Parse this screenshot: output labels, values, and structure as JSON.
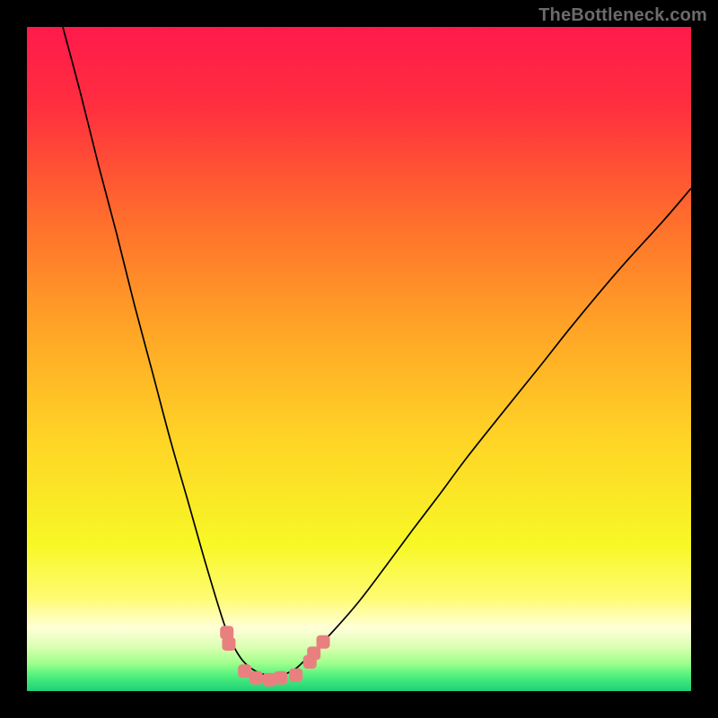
{
  "watermark": "TheBottleneck.com",
  "chart_data": {
    "type": "line",
    "title": "",
    "xlabel": "",
    "ylabel": "",
    "xlim": [
      0,
      100
    ],
    "ylim": [
      0,
      100
    ],
    "grid": false,
    "annotations": [],
    "gradient_stops": [
      {
        "offset": 0.0,
        "color": "#ff1a4b"
      },
      {
        "offset": 0.12,
        "color": "#ff2f3f"
      },
      {
        "offset": 0.28,
        "color": "#ff6a2d"
      },
      {
        "offset": 0.45,
        "color": "#ffa326"
      },
      {
        "offset": 0.62,
        "color": "#ffd426"
      },
      {
        "offset": 0.78,
        "color": "#f7f826"
      },
      {
        "offset": 0.86,
        "color": "#fffb73"
      },
      {
        "offset": 0.905,
        "color": "#ffffd8"
      },
      {
        "offset": 0.935,
        "color": "#d8ffb0"
      },
      {
        "offset": 0.958,
        "color": "#9fff8c"
      },
      {
        "offset": 0.978,
        "color": "#4df07c"
      },
      {
        "offset": 1.0,
        "color": "#1fcf7a"
      }
    ],
    "series": [
      {
        "name": "bottleneck-curve",
        "style": "line",
        "color": "#000000",
        "width": 1.7,
        "x": [
          5.4,
          8.1,
          10.8,
          13.5,
          16.2,
          18.9,
          21.6,
          24.3,
          27.0,
          29.7,
          31.1,
          32.4,
          33.8,
          35.1,
          36.5,
          37.8,
          39.2,
          40.5,
          41.9,
          45.9,
          50.0,
          54.1,
          58.1,
          62.2,
          66.2,
          71.6,
          77.0,
          82.4,
          89.2,
          95.9,
          100.0
        ],
        "y": [
          100.0,
          89.9,
          79.1,
          68.9,
          58.1,
          48.0,
          37.8,
          28.4,
          18.9,
          10.1,
          6.8,
          4.7,
          3.4,
          2.7,
          2.4,
          2.4,
          2.7,
          3.4,
          4.7,
          8.8,
          13.5,
          18.9,
          24.3,
          29.7,
          35.1,
          41.9,
          48.6,
          55.4,
          63.5,
          70.9,
          75.7
        ]
      },
      {
        "name": "bottom-markers",
        "style": "markers",
        "color": "#e98080",
        "size": 15,
        "x": [
          30.1,
          30.4,
          32.8,
          34.5,
          36.5,
          38.2,
          40.5,
          42.6,
          43.2,
          44.6
        ],
        "y": [
          8.8,
          7.1,
          3.0,
          2.0,
          1.7,
          2.0,
          2.4,
          4.4,
          5.7,
          7.4
        ]
      }
    ]
  }
}
